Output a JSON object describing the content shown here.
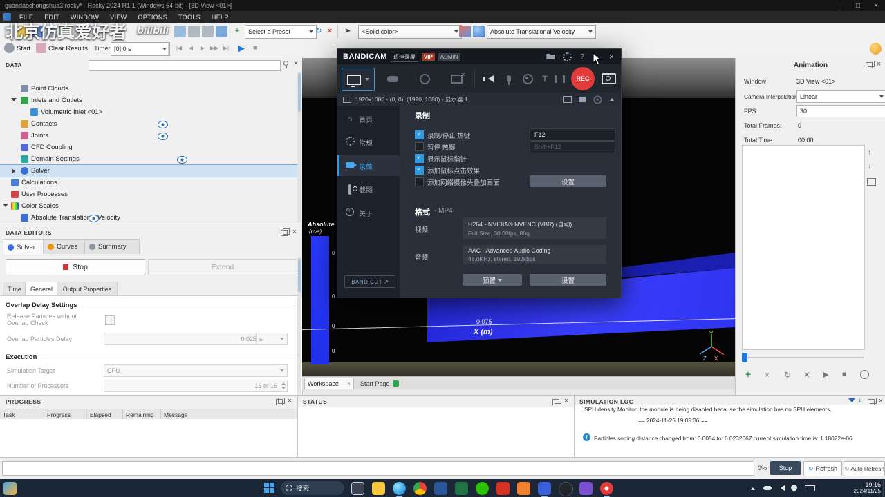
{
  "titlebar": {
    "title": "guandaochongshua3.rocky* - Rocky 2024 R1.1 (Windows 64-bit) - [3D View <01>]",
    "minimize": "–",
    "maximize": "□",
    "close": "×"
  },
  "menubar": {
    "items": [
      "File",
      "Edit",
      "Window",
      "View",
      "Options",
      "Tools",
      "Help"
    ]
  },
  "toolbar": {
    "preset": "Select a Preset",
    "solid_color": "<Solid color>",
    "coloring": "Absolute Translational Velocity"
  },
  "controls_bar": {
    "start": "Start",
    "clear_results": "Clear Results",
    "time_label": "Time:",
    "time_value": "[0] 0 s",
    "media": [
      "|◀",
      "◀",
      "▶",
      "▶▶",
      "▶|"
    ],
    "play": "▶",
    "stop": "■"
  },
  "data_panel": {
    "title": "Data",
    "tree": [
      {
        "label": "Point Clouds"
      },
      {
        "label": "Inlets and Outlets"
      },
      {
        "label": "Volumetric Inlet <01>"
      },
      {
        "label": "Contacts"
      },
      {
        "label": "Joints"
      },
      {
        "label": "CFD Coupling"
      },
      {
        "label": "Domain Settings"
      },
      {
        "label": "Solver"
      },
      {
        "label": "Calculations"
      },
      {
        "label": "User Processes"
      },
      {
        "label": "Color Scales"
      },
      {
        "label": "Absolute Translational Velocity"
      }
    ]
  },
  "data_editors": {
    "title": "Data Editors",
    "tabs": [
      "Solver",
      "Curves",
      "Summary"
    ],
    "stop": "Stop",
    "extend": "Extend",
    "subtabs": [
      "Time",
      "General",
      "Output Properties"
    ],
    "overlap_group": "Overlap Delay Settings",
    "release_label": "Release Particles without Overlap Check",
    "overlap_delay_label": "Overlap Particles Delay",
    "overlap_delay_value": "0.025",
    "overlap_delay_unit": "s",
    "execution_group": "Execution",
    "sim_target_label": "Simulation Target",
    "sim_target_value": "CPU",
    "processors_label": "Number of Processors",
    "processors_value": "16 of 16"
  },
  "viewport": {
    "watermark": "北京仿真爱好者",
    "watermark2": "bilibili",
    "scale_title": "Absolute",
    "scale_unit": "(m/s)",
    "scale_ticks": [
      "0",
      "0",
      "0",
      "0"
    ],
    "axis_tick": "0.075",
    "axis_label": "X (m)",
    "triad": {
      "y": "Y",
      "z": "Z",
      "x": "X"
    }
  },
  "workspace_tabs": {
    "tab1": "Workspace",
    "tab2": "Start Page",
    "close": "×"
  },
  "bandicam": {
    "logo": "BANDICAM",
    "logo_cn": "班迪录屏",
    "vip": "VIP",
    "admin": "ADMIN",
    "rec": "REC",
    "resolution": "1920x1080 - (0, 0), (1920, 1080) - 显示器 1",
    "nav": [
      "首页",
      "常规",
      "录像",
      "截图",
      "关于"
    ],
    "bandicut": "BANDICUT",
    "record_section": "录制",
    "cb_record": "录制/停止 热键",
    "hotkey_record": "F12",
    "cb_pause": "暂停 热键",
    "hotkey_pause": "Shift+F12",
    "cb_cursor": "显示鼠标指针",
    "cb_click_fx": "添加鼠标点击效果",
    "cb_webcam": "添加网络摄像头叠加画面",
    "settings_btn": "设置",
    "format_label": "格式",
    "format_value": "- MP4",
    "video_label": "视频",
    "video_line1": "H264 - NVIDIA® NVENC (VBR) (自动)",
    "video_line2": "Full Size, 30.00fps, 80q",
    "audio_label": "音频",
    "audio_line1": "AAC - Advanced Audio Coding",
    "audio_line2": "48.0KHz, stereo, 192kbps",
    "preset_btn": "预置",
    "settings_btn2": "设置"
  },
  "animation": {
    "title": "Animation",
    "window_label": "Window",
    "window_value": "3D View <01>",
    "interp_label": "Camera Interpolation:",
    "interp_value": "Linear",
    "fps_label": "FPS:",
    "fps_value": "30",
    "frames_label": "Total Frames:",
    "frames_value": "0",
    "total_time_label": "Total Time:",
    "total_time_value": "00:00"
  },
  "progress_panel": {
    "title": "Progress",
    "columns": [
      "Task",
      "Progress",
      "Elapsed",
      "Remaining",
      "Message"
    ]
  },
  "status_panel": {
    "title": "Status"
  },
  "simulation_log": {
    "title": "Simulation Log",
    "line1": "SPH density Monitor: the module is being disabled because the simulation has no SPH elements.",
    "line2": "== 2024-11-25 19:05:36 ==",
    "line3": "Particles sorting distance changed from: 0.0054  to: 0.0232067 current simulation time is: 1.18022e-06"
  },
  "statusbar": {
    "percent": "0%",
    "stop": "Stop",
    "refresh": "Refresh",
    "auto_refresh": "Auto Refresh"
  },
  "taskbar": {
    "search": "搜索",
    "time": "19:16",
    "date": "2024/11/25"
  }
}
